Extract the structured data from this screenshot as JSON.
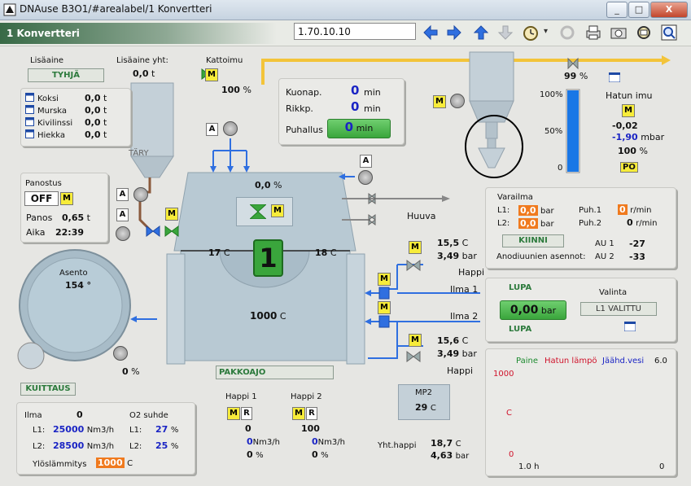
{
  "window": {
    "title": "DNAuse B3O1/#arealabel/1 Konvertteri",
    "btn_min": "_",
    "btn_max": "□",
    "btn_close": "X"
  },
  "header": {
    "title": "1 Konvertteri",
    "version": "1.70.10.10"
  },
  "toolbar": [
    "back-arrow",
    "forward-arrow",
    "up-arrow",
    "down-arrow",
    "clock-gear",
    "refresh",
    "print",
    "camera",
    "settings",
    "zoom"
  ],
  "additive": {
    "label": "Lisäaine",
    "status": "TYHJÄ",
    "total_label": "Lisäaine yht:",
    "total_value": "0,0",
    "total_unit": "t",
    "items": [
      {
        "name": "Koksi",
        "value": "0,0",
        "unit": "t"
      },
      {
        "name": "Murska",
        "value": "0,0",
        "unit": "t"
      },
      {
        "name": "Kivilinssi",
        "value": "0,0",
        "unit": "t"
      },
      {
        "name": "Hiekka",
        "value": "0,0",
        "unit": "t"
      }
    ],
    "silo_label": "TÄRY"
  },
  "roof_blow": {
    "label": "Kattoimu",
    "value": "100",
    "unit": "%"
  },
  "timers": {
    "kuonap_label": "Kuonap.",
    "kuonap_value": "0",
    "kuonap_unit": "min",
    "rikkp_label": "Rikkp.",
    "rikkp_value": "0",
    "rikkp_unit": "min",
    "puhallus_label": "Puhallus",
    "puhallus_value": "0",
    "puhallus_unit": "min"
  },
  "charging": {
    "label": "Panostus",
    "state": "OFF",
    "panos_label": "Panos",
    "panos_value": "0,65",
    "panos_unit": "t",
    "aika_label": "Aika",
    "aika_value": "22:39"
  },
  "converter": {
    "number": "1",
    "tilt_pct": "0,0",
    "tilt_unit": "%",
    "temp_left": "17",
    "temp_right": "18",
    "temp_unit": "C",
    "temp_main": "1000",
    "temp_main_unit": "C",
    "pakkoajo": "PAKKOAJO"
  },
  "position": {
    "label": "Asento",
    "value": "154",
    "unit": "°",
    "motor_pct": "0",
    "motor_unit": "%"
  },
  "hood": {
    "top_pct": "99",
    "top_unit": "%",
    "scale": [
      "100%",
      "50%",
      "0"
    ],
    "fill_fraction": 1.0,
    "imu_label": "Hatun imu",
    "imu_a": "-0,02",
    "imu_b": "-1,90",
    "imu_unit": "mbar",
    "imu_pct": "100",
    "imu_pct_unit": "%",
    "po": "PO"
  },
  "huuva": "Huuva",
  "oxygen_side": {
    "t1": "15,5",
    "t1_unit": "C",
    "p1": "3,49",
    "p1_unit": "bar",
    "happi_label": "Happi",
    "ilma1": "Ilma 1",
    "ilma2": "Ilma 2",
    "t2": "15,6",
    "t2_unit": "C",
    "p2": "3,49",
    "p2_unit": "bar",
    "happi2_label": "Happi"
  },
  "reserve_air": {
    "label": "Varailma",
    "l1_label": "L1:",
    "l1_value": "0,0",
    "l1_unit": "bar",
    "l2_label": "L2:",
    "l2_value": "0,0",
    "l2_unit": "bar",
    "puh1_label": "Puh.1",
    "puh1_value": "0",
    "puh1_unit": "r/min",
    "puh2_label": "Puh.2",
    "puh2_value": "0",
    "puh2_unit": "r/min",
    "kiinni": "KIINNI",
    "au1_label": "AU 1",
    "au1_value": "-27",
    "au2_label": "AU 2",
    "au2_value": "-33",
    "anode_label": "Anodiuunien asennot:"
  },
  "permit": {
    "lupa_top": "LUPA",
    "pressure": "0,00",
    "pressure_unit": "bar",
    "lupa_bottom": "LUPA",
    "valinta_label": "Valinta",
    "valinta_value": "L1 VALITTU"
  },
  "trend": {
    "legend": [
      {
        "name": "Paine",
        "color": "#1b8a2e"
      },
      {
        "name": "Hatun lämpö",
        "color": "#d0132b"
      },
      {
        "name": "Jäähd.vesi",
        "color": "#1a24c4"
      }
    ],
    "right_value": "6.0",
    "y_top": "1000",
    "y_mid": "C",
    "y_bottom": "0",
    "x_left": "1.0 h",
    "x_right": "0"
  },
  "kuittaus": "KUITTAUS",
  "air_panel": {
    "ilma_label": "Ilma",
    "ilma_value": "0",
    "l1_label": "L1:",
    "l1_value": "25000",
    "l1_unit": "Nm3/h",
    "l2_label": "L2:",
    "l2_value": "28500",
    "l2_unit": "Nm3/h",
    "o2_label": "O2 suhde",
    "o2_l1_label": "L1:",
    "o2_l1_value": "27",
    "o2_l1_unit": "%",
    "o2_l2_label": "L2:",
    "o2_l2_value": "25",
    "o2_l2_unit": "%",
    "preheat_label": "Ylöslämmitys",
    "preheat_value": "1000",
    "preheat_unit": "C"
  },
  "oxygen": {
    "h1_label": "Happi 1",
    "h1_value": "0",
    "h1_flow": "0",
    "h1_flow_unit": "Nm3/h",
    "h1_pct": "0",
    "h1_pct_unit": "%",
    "h2_label": "Happi 2",
    "h2_value": "100",
    "h2_flow": "0",
    "h2_flow_unit": "Nm3/h",
    "h2_pct": "0",
    "h2_pct_unit": "%",
    "mp2_label": "MP2",
    "mp2_value": "29",
    "mp2_unit": "C",
    "total_label": "Yht.happi",
    "total_t": "18,7",
    "total_t_unit": "C",
    "total_p": "4,63",
    "total_p_unit": "bar"
  },
  "letters": {
    "m": "M",
    "a": "A",
    "r": "R"
  }
}
